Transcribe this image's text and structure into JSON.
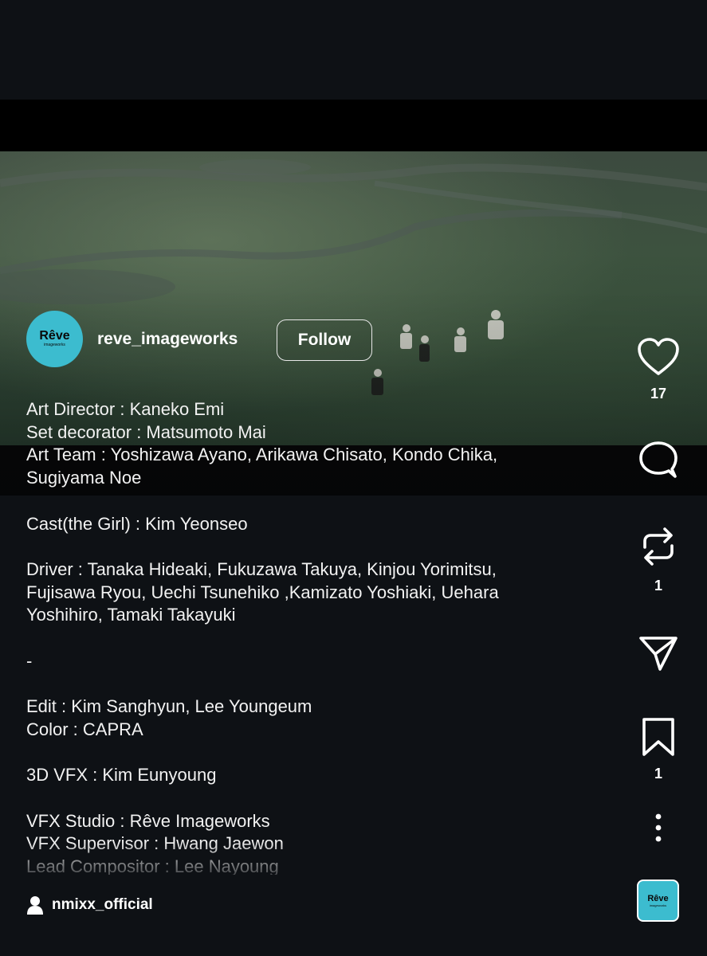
{
  "author": {
    "username": "reve_imageworks",
    "avatar_text": "Rêve",
    "avatar_subtext": "imageworks",
    "follow_label": "Follow"
  },
  "caption": [
    "Art Director : Kaneko Emi",
    "Set decorator : Matsumoto Mai",
    "Art Team : Yoshizawa Ayano, Arikawa Chisato, Kondo Chika,",
    "Sugiyama Noe",
    "",
    "Cast(the Girl) : Kim Yeonseo",
    "",
    "Driver : Tanaka Hideaki, Fukuzawa Takuya, Kinjou Yorimitsu,",
    "Fujisawa Ryou, Uechi Tsunehiko ,Kamizato Yoshiaki, Uehara",
    "Yoshihiro, Tamaki Takayuki",
    "",
    "-",
    "",
    "Edit : Kim Sanghyun, Lee Youngeum",
    "Color : CAPRA",
    "",
    "3D VFX : Kim Eunyoung",
    "",
    "VFX Studio : Rêve Imageworks",
    "VFX Supervisor : Hwang Jaewon",
    "Lead Compositor : Lee Nayoung"
  ],
  "actions": {
    "like": {
      "icon": "heart-icon",
      "count": "17"
    },
    "comment": {
      "icon": "comment-icon",
      "count": ""
    },
    "repost": {
      "icon": "repost-icon",
      "count": "1"
    },
    "share": {
      "icon": "send-icon",
      "count": ""
    },
    "save": {
      "icon": "bookmark-icon",
      "count": "1"
    },
    "more": {
      "icon": "more-vertical-icon"
    }
  },
  "tagged": {
    "icon": "person-icon",
    "username": "nmixx_official"
  },
  "audio_avatar": {
    "text": "Rêve",
    "subtext": "imageworks"
  },
  "colors": {
    "background": "#0e1115",
    "avatar_bg": "#3cbccf",
    "text": "#ffffff"
  }
}
